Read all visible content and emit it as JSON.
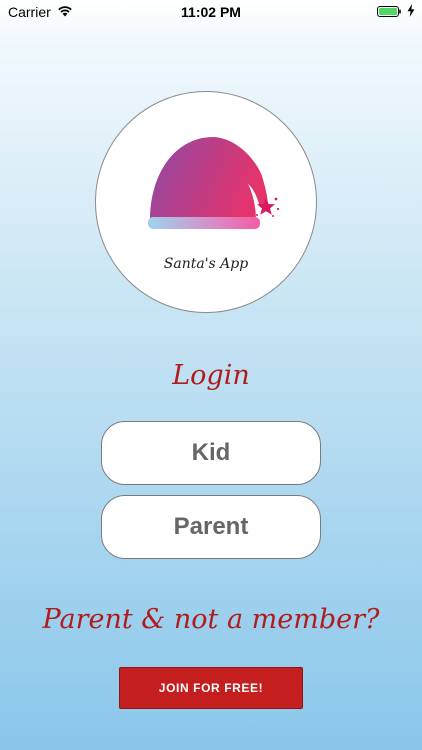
{
  "status_bar": {
    "carrier": "Carrier",
    "time": "11:02 PM",
    "wifi_icon": "wifi-icon",
    "battery_icon": "battery-icon",
    "charging_icon": "bolt-icon",
    "battery_color": "#4cd964"
  },
  "logo": {
    "text": "Santa's App",
    "icon": "santa-hat-icon",
    "hat_colors": [
      "#8e4aa6",
      "#e5336b"
    ]
  },
  "login": {
    "title": "Login",
    "kid_label": "Kid",
    "parent_label": "Parent"
  },
  "signup": {
    "question": "Parent & not a member?",
    "join_label": "JOIN FOR FREE!",
    "accent": "#c41e1e"
  }
}
